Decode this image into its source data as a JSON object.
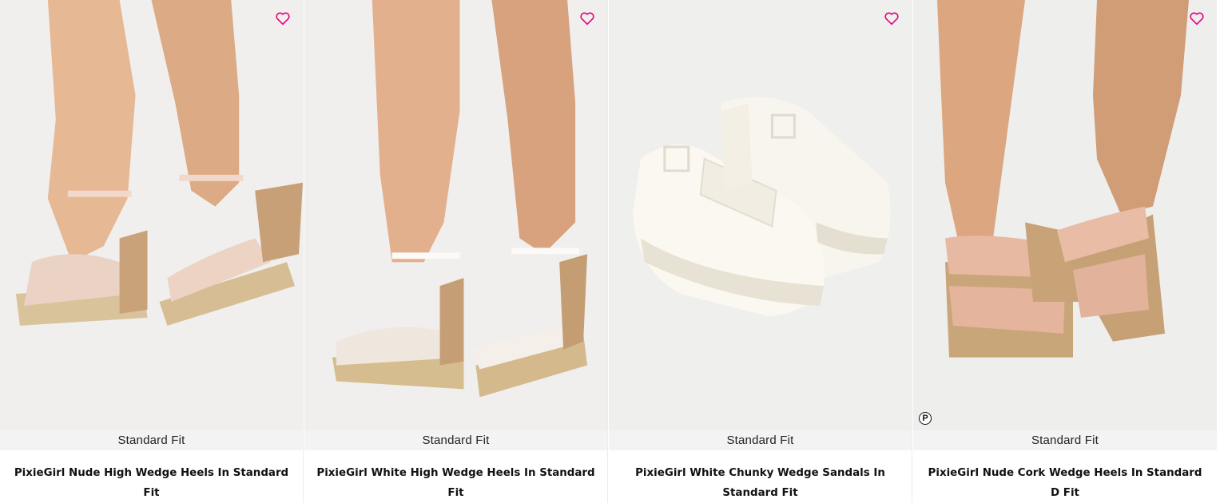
{
  "products": [
    {
      "fit_label": "Standard Fit",
      "title": "PixieGirl Nude High Wedge Heels In Standard Fit",
      "wishlist_icon": "heart-outline-icon",
      "accent_color": "#e6007e"
    },
    {
      "fit_label": "Standard Fit",
      "title": "PixieGirl White High Wedge Heels In Standard Fit",
      "wishlist_icon": "heart-outline-icon",
      "accent_color": "#e6007e"
    },
    {
      "fit_label": "Standard Fit",
      "title": "PixieGirl White Chunky Wedge Sandals In Standard Fit",
      "wishlist_icon": "heart-outline-icon",
      "accent_color": "#e6007e"
    },
    {
      "fit_label": "Standard Fit",
      "title": "PixieGirl Nude Cork Wedge Heels In Standard D Fit",
      "wishlist_icon": "heart-outline-icon",
      "accent_color": "#e6007e",
      "badge_letter": "P"
    }
  ]
}
